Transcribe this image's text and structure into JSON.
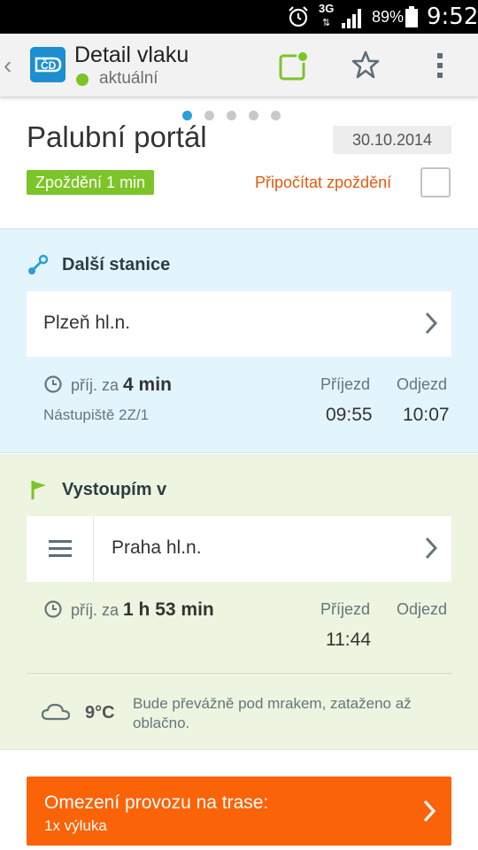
{
  "status_bar": {
    "network": "3G",
    "battery": "89%",
    "time": "9:52",
    "icons": [
      "alarm-icon",
      "signal-icon",
      "battery-icon"
    ]
  },
  "action_bar": {
    "title": "Detail vlaku",
    "subtitle": "aktuální",
    "icons": [
      "back-chevron-icon",
      "cd-logo",
      "portal-icon",
      "star-icon",
      "overflow-menu-icon"
    ]
  },
  "header": {
    "page_title": "Palubní portál",
    "date": "30.10.2014",
    "delay_badge": "Zpoždění 1 min",
    "add_delay_label": "Připočítat zpoždění",
    "add_delay_checked": false,
    "pager": {
      "count": 5,
      "active": 0
    }
  },
  "next_station": {
    "title": "Další stanice",
    "station": "Plzeň hl.n.",
    "eta_prefix": "příj. za",
    "eta_value": "4 min",
    "platform": "Nástupiště 2Z/1",
    "arrival_label": "Příjezd",
    "departure_label": "Odjezd",
    "arrival": "09:55",
    "departure": "10:07"
  },
  "destination": {
    "title": "Vystoupím v",
    "station": "Praha hl.n.",
    "eta_prefix": "příj. za",
    "eta_value": "1 h 53 min",
    "arrival_label": "Příjezd",
    "departure_label": "Odjezd",
    "arrival": "11:44"
  },
  "weather": {
    "temperature": "9°C",
    "description": "Bude převážně pod mrakem, zataženo až oblačno."
  },
  "alert": {
    "title": "Omezení provozu na trase:",
    "subtitle": "1x výluka"
  },
  "colors": {
    "accent_green": "#7cc427",
    "accent_orange": "#fa6307",
    "link_orange": "#e35a0a",
    "accent_blue": "#2a9fd8",
    "next_station_bg": "#e3f5fc",
    "destination_bg": "#edf4df"
  }
}
